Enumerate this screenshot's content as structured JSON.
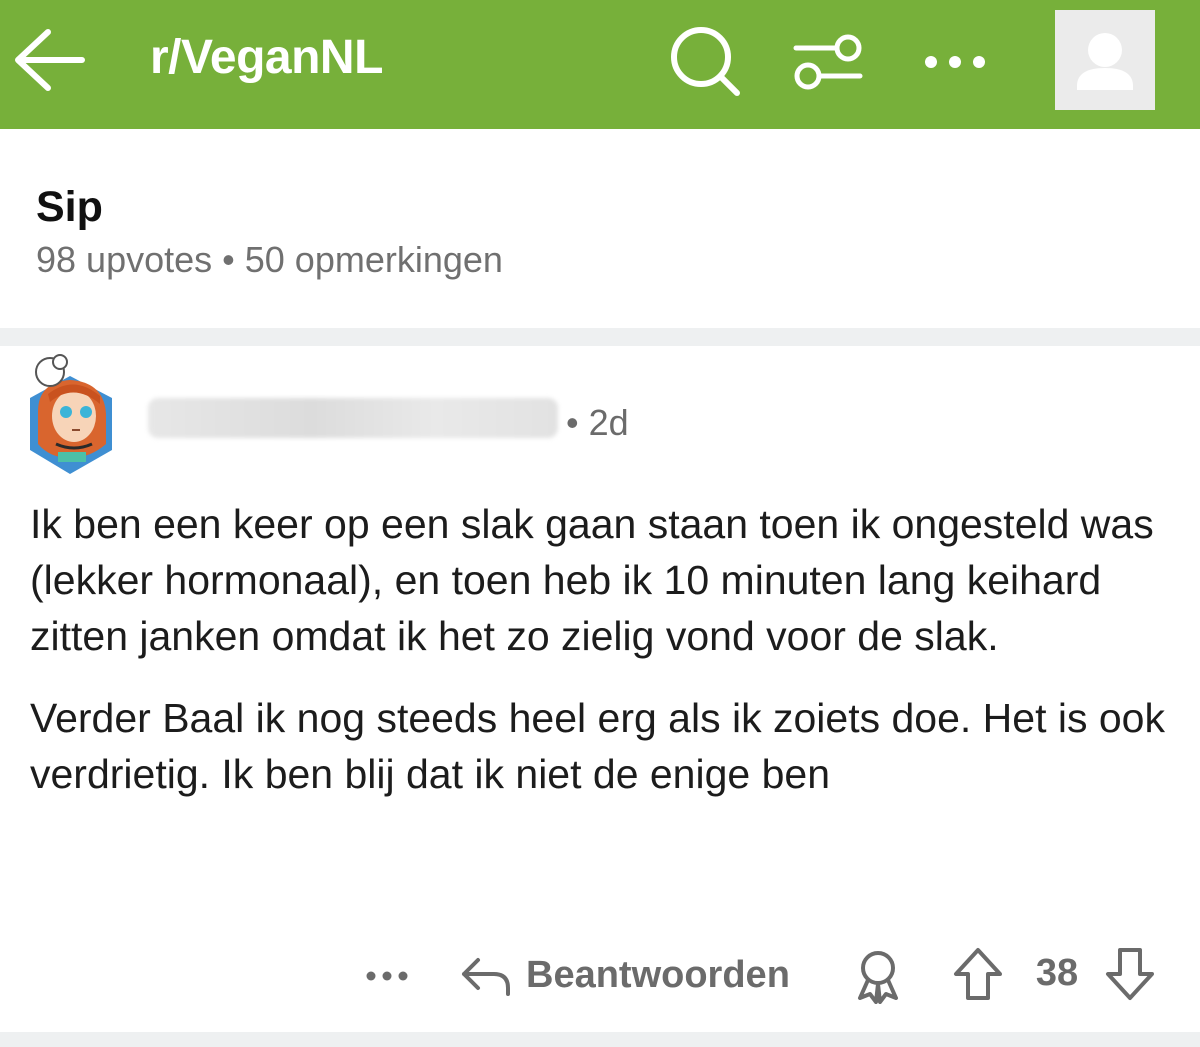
{
  "topbar": {
    "subreddit": "r/VeganNL",
    "color": "#77b03a",
    "icons": [
      "back-arrow-icon",
      "search-icon",
      "filter-icon",
      "more-icon",
      "user-avatar-icon"
    ]
  },
  "post": {
    "title": "Sip",
    "upvotes": "98 upvotes",
    "separator": "•",
    "comments": "50 opmerkingen"
  },
  "comment": {
    "time": "• 2d",
    "paragraphs": [
      "Ik ben een keer op een slak gaan staan toen ik ongesteld was (lekker hormonaal), en toen heb ik 10 minuten lang keihard zitten janken omdat ik het zo zielig vond voor de slak.",
      "Verder Baal ik nog steeds heel erg als ik zoiets doe. Het is ook verdrietig. Ik ben blij dat ik niet de enige ben"
    ],
    "actions": {
      "reply_label": "Beantwoorden",
      "score": "38"
    }
  }
}
